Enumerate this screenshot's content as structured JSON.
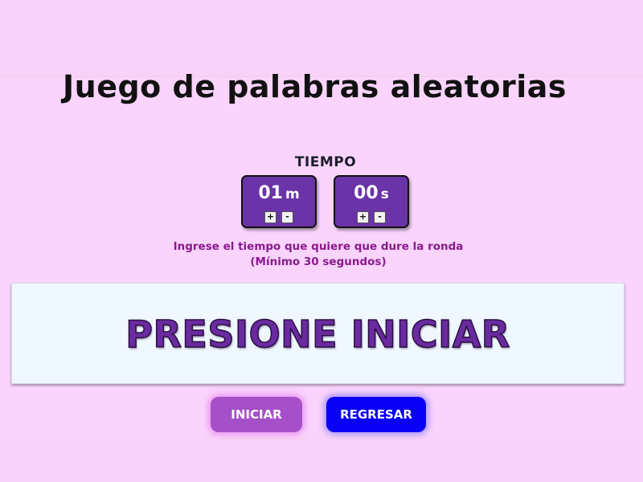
{
  "page": {
    "title": "Juego de palabras aleatorias"
  },
  "timer": {
    "label": "TIEMPO",
    "minutes": {
      "value": "01",
      "unit": "m",
      "increment_label": "+",
      "decrement_label": "-"
    },
    "seconds": {
      "value": "00",
      "unit": "s",
      "increment_label": "+",
      "decrement_label": "-"
    },
    "hint_line1": "Ingrese el tiempo que quiere que dure la ronda",
    "hint_line2": "(Mínimo 30 segundos)"
  },
  "display": {
    "word": "PRESIONE INICIAR"
  },
  "actions": {
    "start_label": "INICIAR",
    "back_label": "REGRESAR"
  },
  "colors": {
    "background": "#f8d2f8",
    "timer_box": "#6a33a8",
    "hint_text": "#8a1a8c",
    "word_text": "#6a2aa0",
    "start_button": "#a550c8",
    "back_button": "#0a00f5"
  }
}
